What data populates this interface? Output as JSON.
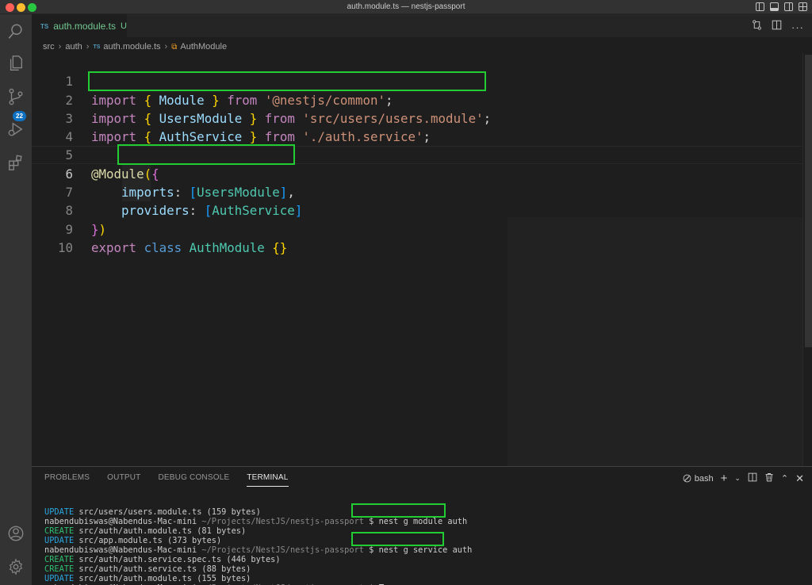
{
  "window": {
    "title": "auth.module.ts — nestjs-passport"
  },
  "activity_bar": {
    "source_control_badge": "22"
  },
  "tab": {
    "badge": "TS",
    "name": "auth.module.ts",
    "status": "U"
  },
  "breadcrumb": {
    "parts": [
      "src",
      "auth",
      "auth.module.ts",
      "AuthModule"
    ],
    "ts_badge": "TS"
  },
  "editor": {
    "active_line": 6,
    "line_numbers": [
      "1",
      "2",
      "3",
      "4",
      "5",
      "6",
      "7",
      "8",
      "9",
      "10"
    ],
    "lines": {
      "l1": {
        "kw": "import",
        "b1": "{",
        "id": "Module",
        "b2": "}",
        "from": "from",
        "str": "'@nestjs/common'",
        "end": ";"
      },
      "l2": {
        "kw": "import",
        "b1": "{",
        "id": "UsersModule",
        "b2": "}",
        "from": "from",
        "str": "'src/users/users.module'",
        "end": ";"
      },
      "l3": {
        "kw": "import",
        "b1": "{",
        "id": "AuthService",
        "b2": "}",
        "from": "from",
        "str": "'./auth.service'",
        "end": ";"
      },
      "l5": {
        "dec": "@",
        "fn": "Module",
        "p": "(",
        "b": "{"
      },
      "l6": {
        "prop": "imports",
        "colon": ":",
        "lb": "[",
        "val": "UsersModule",
        "rb": "]",
        "comma": ","
      },
      "l7": {
        "prop": "providers",
        "colon": ":",
        "lb": "[",
        "val": "AuthService",
        "rb": "]"
      },
      "l8": {
        "b": "}",
        "p": ")"
      },
      "l9": {
        "kw1": "export",
        "kw2": "class",
        "cls": "AuthModule",
        "body": "{}"
      }
    }
  },
  "panel": {
    "tabs": [
      "PROBLEMS",
      "OUTPUT",
      "DEBUG CONSOLE",
      "TERMINAL"
    ],
    "active_tab": "TERMINAL",
    "shell": "bash",
    "terminal": {
      "prompt_user": "nabendubiswas@Nabendus-Mac-mini",
      "prompt_path": "~/Projects/NestJS/nestjs-passport",
      "prompt_symbol": "$",
      "lines": [
        {
          "type": "output",
          "tag": "UPDATE",
          "text": "src/users/users.module.ts (159 bytes)"
        },
        {
          "type": "prompt",
          "cmd": "nest g module auth"
        },
        {
          "type": "output",
          "tag": "CREATE",
          "text": "src/auth/auth.module.ts (81 bytes)"
        },
        {
          "type": "output",
          "tag": "UPDATE",
          "text": "src/app.module.ts (373 bytes)"
        },
        {
          "type": "prompt",
          "cmd": "nest g service auth"
        },
        {
          "type": "output",
          "tag": "CREATE",
          "text": "src/auth/auth.service.spec.ts (446 bytes)"
        },
        {
          "type": "output",
          "tag": "CREATE",
          "text": "src/auth/auth.service.ts (88 bytes)"
        },
        {
          "type": "output",
          "tag": "UPDATE",
          "text": "src/auth/auth.module.ts (155 bytes)"
        },
        {
          "type": "prompt",
          "cmd": ""
        }
      ]
    }
  },
  "colors": {
    "highlight_box": "#22cc33",
    "accent": "#0e70c0",
    "modified": "#73c991"
  }
}
